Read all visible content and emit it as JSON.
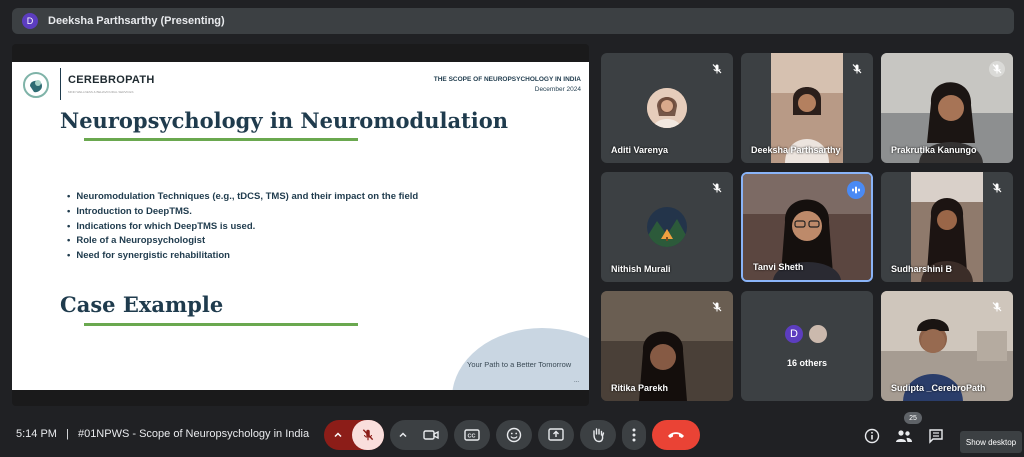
{
  "presenter_bar": {
    "avatar_letter": "D",
    "title": "Deeksha Parthsarthy (Presenting)"
  },
  "slide": {
    "brand": "CEREBROPATH",
    "brand_sub": "MIND WELLNESS & BEHAVIOURAL SERVICES",
    "scope": "THE SCOPE OF NEUROPSYCHOLOGY IN INDIA",
    "date": "December 2024",
    "heading": "Neuropsychology in Neuromodulation",
    "bullets": [
      "Neuromodulation Techniques (e.g., tDCS, TMS) and their impact on the field",
      "Introduction to DeepTMS.",
      "Indications for which DeepTMS is used.",
      "Role of a Neuropsychologist",
      "Need for synergistic rehabilitation"
    ],
    "heading2": "Case Example",
    "tagline": "Your Path to a Better Tomorrow",
    "dots": "..."
  },
  "participants": [
    {
      "name": "Aditi Varenya",
      "muted": true
    },
    {
      "name": "Deeksha Parthsarthy",
      "muted": true
    },
    {
      "name": "Prakrutika Kanungo",
      "muted": true
    },
    {
      "name": "Nithish Murali",
      "muted": true
    },
    {
      "name": "Tanvi Sheth",
      "muted": false,
      "speaking": true
    },
    {
      "name": "Sudharshini B",
      "muted": true
    },
    {
      "name": "Ritika Parekh",
      "muted": true
    },
    {
      "name": "Sudipta _CerebroPath",
      "muted": true
    }
  ],
  "others": {
    "avatar_letter": "D",
    "label": "16 others"
  },
  "bottom_bar": {
    "time": "5:14 PM",
    "separator": "|",
    "meeting_name": "#01NPWS - Scope of Neuropsychology in India",
    "people_count": "25",
    "tooltip": "Show desktop"
  },
  "colors": {
    "accent_green": "#6aa84f",
    "slide_navy": "#1f3b4d",
    "end_call": "#ea4335",
    "mic_muted_bg": "#f9dedc",
    "speaking": "#4a8af4"
  }
}
